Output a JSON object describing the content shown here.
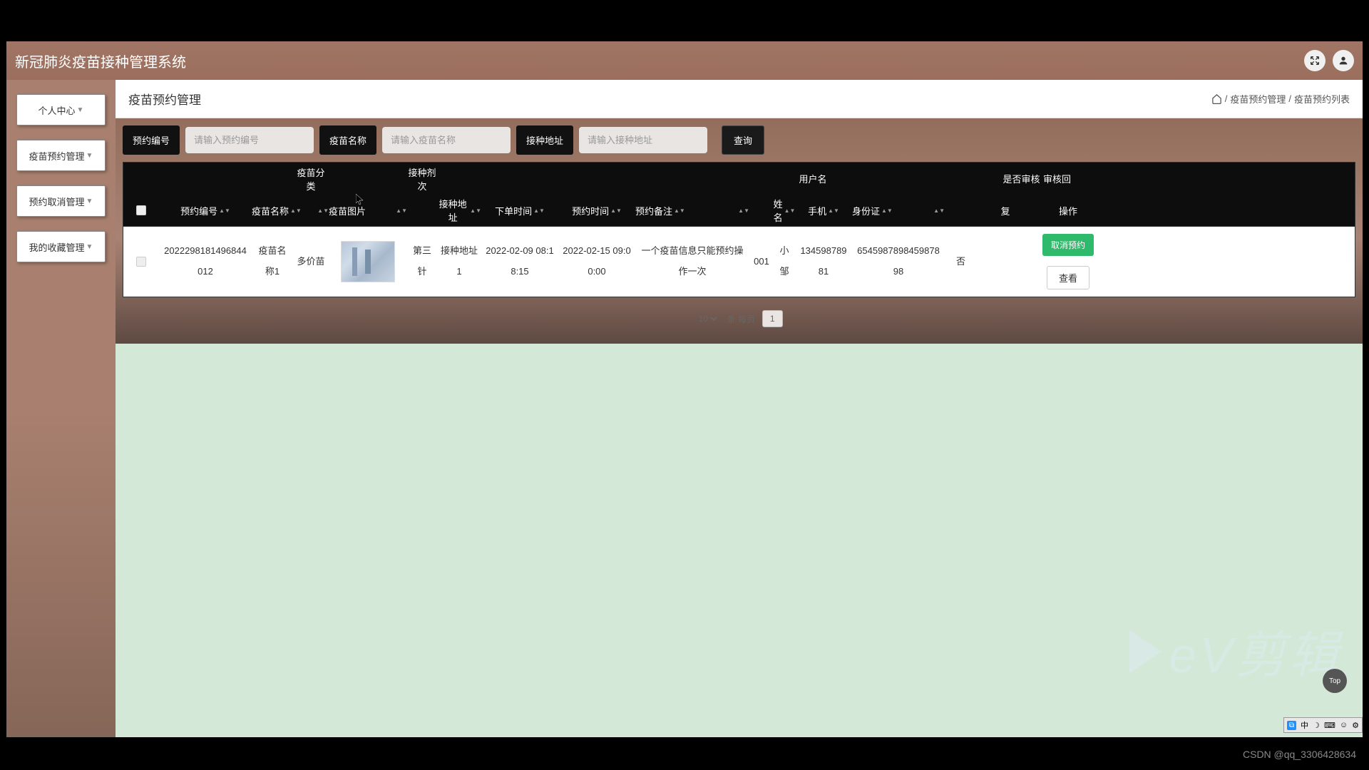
{
  "header": {
    "title": "新冠肺炎疫苗接种管理系统"
  },
  "sidebar": {
    "items": [
      {
        "label": "个人中心"
      },
      {
        "label": "疫苗预约管理"
      },
      {
        "label": "预约取消管理"
      },
      {
        "label": "我的收藏管理"
      }
    ]
  },
  "breadcrumb": {
    "page_title": "疫苗预约管理",
    "sep": "/",
    "part1": "疫苗预约管理",
    "part2": "疫苗预约列表"
  },
  "filters": {
    "label_id": "预约编号",
    "placeholder_id": "请输入预约编号",
    "label_name": "疫苗名称",
    "placeholder_name": "请输入疫苗名称",
    "label_addr": "接种地址",
    "placeholder_addr": "请输入接种地址",
    "query": "查询"
  },
  "table": {
    "header_extra": {
      "category": "疫苗分类",
      "dose": "接种剂次",
      "username": "用户名",
      "is_audit": "是否审核",
      "reply": "审核回"
    },
    "headers": {
      "id": "预约编号",
      "name": "疫苗名称",
      "img": "疫苗图片",
      "addr": "接种地址",
      "order_time": "下单时间",
      "appt_time": "预约时间",
      "note": "预约备注",
      "uname": "姓名",
      "phone": "手机",
      "idcard": "身份证",
      "reply2": "复",
      "action": "操作"
    },
    "row": {
      "id": "2022298181496844012",
      "name": "疫苗名称1",
      "category": "多价苗",
      "dose": "第三针",
      "addr": "接种地址1",
      "order_time": "2022-02-09 08:18:15",
      "appt_time": "2022-02-15 09:00:00",
      "note": "一个疫苗信息只能预约操作一次",
      "usernum": "001",
      "uname": "小邹",
      "phone": "13459878981",
      "idcard": "654598789845987898",
      "is_audit": "否",
      "cancel": "取消预约",
      "view": "查看"
    }
  },
  "pagination": {
    "page_size": "10",
    "total_label": "条 每页",
    "current": "1"
  },
  "top_btn": "Top",
  "ime": {
    "zhong": "中"
  },
  "csdn": "CSDN @qq_3306428634",
  "watermark": "eV剪辑"
}
